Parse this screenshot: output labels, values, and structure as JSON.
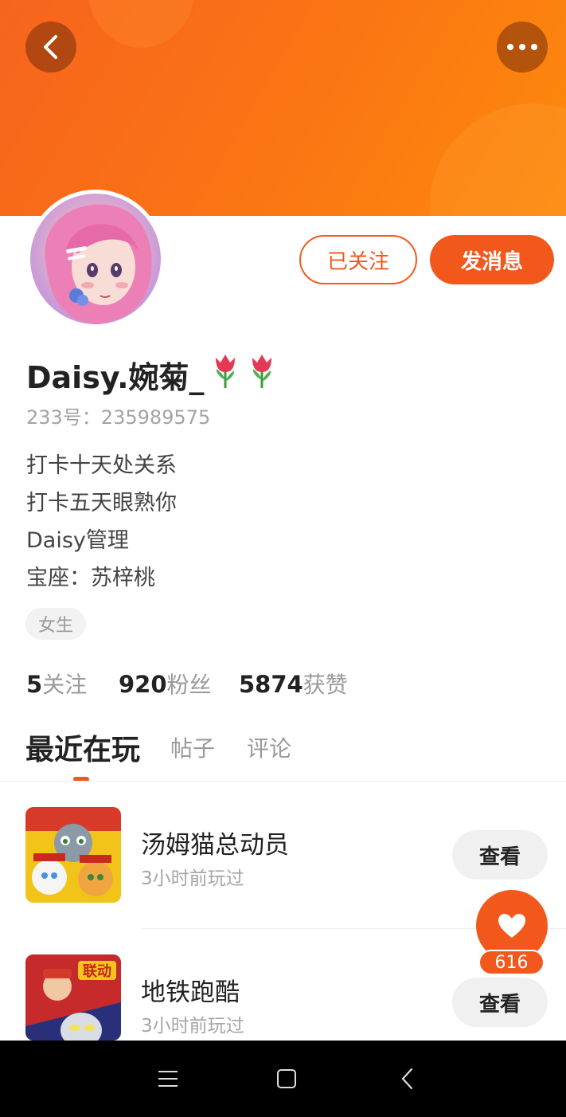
{
  "header": {
    "back_icon": "chevron-left-icon",
    "more_icon": "more-dots-icon"
  },
  "profile": {
    "name": "Daisy.婉菊_",
    "name_emoji": [
      "tulip",
      "tulip"
    ],
    "uid": "233号：235989575",
    "bio": [
      "打卡十天处关系",
      "打卡五天眼熟你",
      "Daisy管理",
      "宝座：苏梓桃"
    ],
    "gender_tag": "女生"
  },
  "actions": {
    "following_label": "已关注",
    "message_label": "发消息"
  },
  "stats": [
    {
      "num": "5",
      "label": "关注"
    },
    {
      "num": "920",
      "label": "粉丝"
    },
    {
      "num": "5874",
      "label": "获赞"
    }
  ],
  "tabs": [
    {
      "label": "最近在玩",
      "active": true
    },
    {
      "label": "帖子",
      "active": false
    },
    {
      "label": "评论",
      "active": false
    }
  ],
  "games": [
    {
      "name": "汤姆猫总动员",
      "time": "3小时前玩过",
      "button": "查看"
    },
    {
      "name": "地铁跑酷",
      "time": "3小时前玩过",
      "button": "查看",
      "icon_badge": "联动"
    }
  ],
  "like": {
    "count": "616"
  },
  "colors": {
    "accent": "#f2581b",
    "banner_start": "#f7641e",
    "banner_end": "#fd8a0c"
  }
}
